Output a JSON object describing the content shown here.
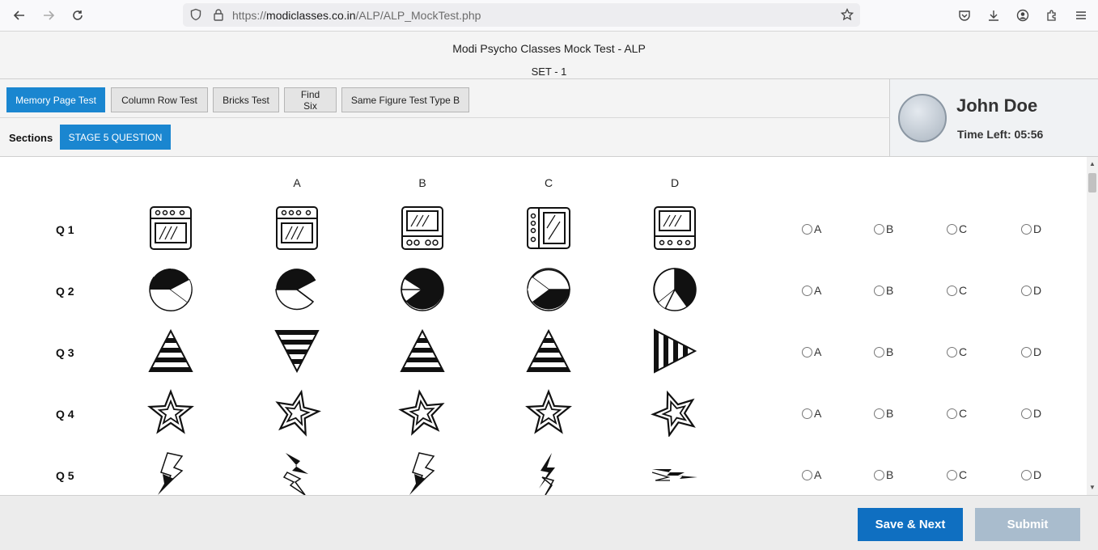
{
  "browser": {
    "url_prefix": "https://",
    "url_host": "modiclasses.co.in",
    "url_path": "/ALP/ALP_MockTest.php"
  },
  "header": {
    "title": "Modi Psycho Classes Mock Test - ALP",
    "set_label": "SET - 1"
  },
  "tabs": [
    {
      "label": "Memory Page Test",
      "active": true
    },
    {
      "label": "Column Row Test",
      "active": false
    },
    {
      "label": "Bricks Test",
      "active": false
    },
    {
      "label": "Find Six",
      "active": false
    },
    {
      "label": "Same Figure Test Type B",
      "active": false
    }
  ],
  "sections": {
    "label": "Sections",
    "stage_button": "STAGE 5 QUESTION"
  },
  "profile": {
    "name": "John Doe",
    "time_left": "Time Left: 05:56"
  },
  "columns": [
    "A",
    "B",
    "C",
    "D"
  ],
  "questions": [
    {
      "label": "Q 1",
      "figure": "oven-icon"
    },
    {
      "label": "Q 2",
      "figure": "pie-icon"
    },
    {
      "label": "Q 3",
      "figure": "striped-triangle-icon"
    },
    {
      "label": "Q 4",
      "figure": "star-icon"
    },
    {
      "label": "Q 5",
      "figure": "lightning-icon"
    }
  ],
  "options": [
    "A",
    "B",
    "C",
    "D"
  ],
  "footer": {
    "save_label": "Save & Next",
    "submit_label": "Submit"
  }
}
